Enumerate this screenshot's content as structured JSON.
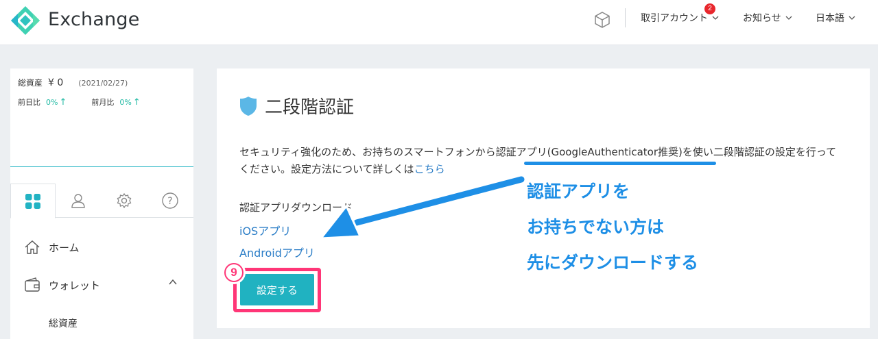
{
  "header": {
    "brand": "Exchange",
    "nav": [
      {
        "label": "取引アカウント",
        "badge": "2"
      },
      {
        "label": "お知らせ"
      },
      {
        "label": "日本語"
      }
    ]
  },
  "sidebar": {
    "assets": {
      "label": "総資産",
      "amount": "¥ 0",
      "date": "(2021/02/27)",
      "day_label": "前日比",
      "day_pct": "0%",
      "month_label": "前月比",
      "month_pct": "0%"
    },
    "tabs": [
      "dashboard-icon",
      "user-icon",
      "gear-icon",
      "help-icon"
    ],
    "menu": {
      "home": "ホーム",
      "wallet": "ウォレット",
      "total_assets": "総資産"
    }
  },
  "main": {
    "title": "二段階認証",
    "desc_part1": "セキュリティ強化のため、お持ちのスマートフォンから",
    "desc_highlight": "認証アプリ(GoogleAuthenticator推奨)",
    "desc_part2": "を使い二段階認証の設定を行ってください。設定方法について詳しくは",
    "desc_link": "こちら",
    "download_title": "認証アプリダウンロード",
    "ios_link": "iOSアプリ",
    "android_link": "Androidアプリ",
    "setup_button": "設定する"
  },
  "annotation": {
    "step": "9",
    "callout_lines": [
      "認証アプリを",
      "お持ちでない方は",
      "先にダウンロードする"
    ]
  },
  "colors": {
    "accent": "#20b2c1",
    "link": "#2c7ec7",
    "callout": "#1e8fe6",
    "highlight_frame": "#ff3677",
    "badge": "#e8272d"
  }
}
